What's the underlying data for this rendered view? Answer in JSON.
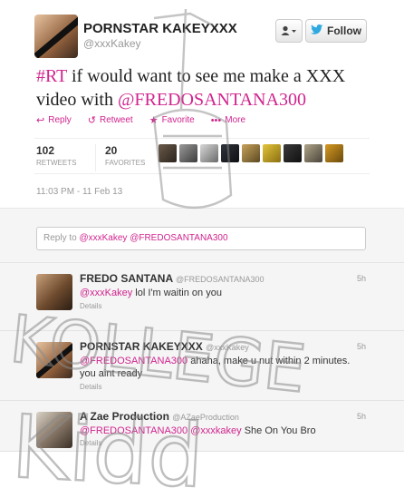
{
  "tweet": {
    "author_name": "PORNSTAR KAKEYXXX",
    "author_handle": "@xxxKakey",
    "follow_label": "Follow",
    "user_menu_icon": "user-dropdown-icon",
    "text_hashtag": "#RT",
    "text_middle": " if would want to see me make a XXX video with ",
    "text_mention": "@FREDOSANTANA300",
    "actions": {
      "reply": "Reply",
      "retweet": "Retweet",
      "favorite": "Favorite",
      "more": "More"
    },
    "retweets_count": "102",
    "retweets_label": "RETWEETS",
    "favorites_count": "20",
    "favorites_label": "FAVORITES",
    "timestamp": "11:03 PM - 11 Feb 13"
  },
  "reply_box": {
    "prefix": "Reply to ",
    "mention1": "@xxxKakey",
    "mention2": "@FREDOSANTANA300"
  },
  "replies": [
    {
      "name": "FREDO SANTANA",
      "handle": "@FREDOSANTANA300",
      "time": "5h",
      "mention": "@xxxKakey",
      "text": " lol I'm waitin on you",
      "details": "Details"
    },
    {
      "name": "PORNSTAR KAKEYXXX",
      "handle": "@xxxKakey",
      "time": "5h",
      "mention": "@FREDOSANTANA300",
      "text": " ahaha, make u nut within 2 minutes. you aint ready",
      "details": "Details"
    },
    {
      "name": "A Zae Production",
      "handle": "@AZaeProduction",
      "time": "5h",
      "mention": "@FREDOSANTANA300",
      "mention2": "@xxxkakey",
      "text": " She On You Bro",
      "details": "Details"
    }
  ],
  "watermark": {
    "line1": "KOLLEGE",
    "line2": "Kidd"
  },
  "colors": {
    "accent": "#d1248e",
    "twitter_blue": "#2fa8e0"
  }
}
